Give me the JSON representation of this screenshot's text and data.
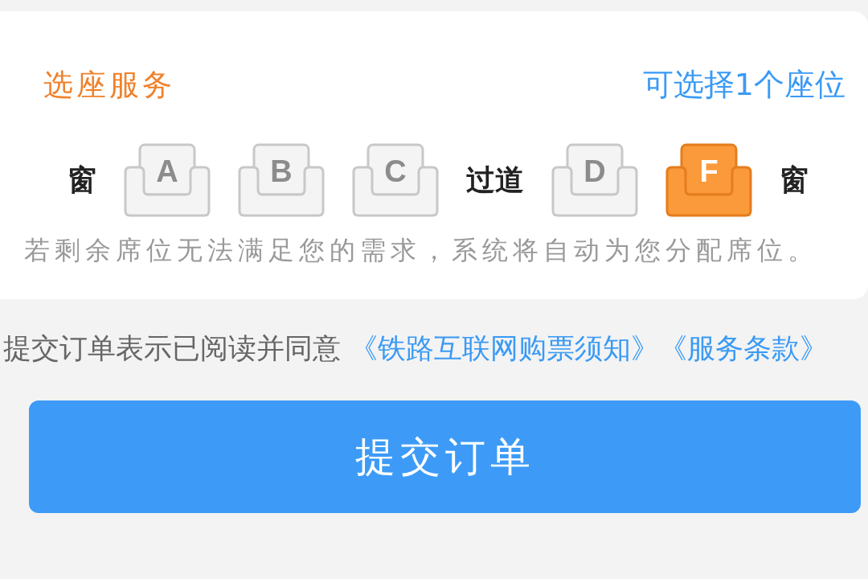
{
  "seat_card": {
    "title": "选座服务",
    "hint": "可选择1个座位",
    "row": [
      {
        "kind": "label",
        "text": "窗"
      },
      {
        "kind": "seat",
        "text": "A",
        "selected": false
      },
      {
        "kind": "seat",
        "text": "B",
        "selected": false
      },
      {
        "kind": "seat",
        "text": "C",
        "selected": false
      },
      {
        "kind": "label",
        "text": "过道"
      },
      {
        "kind": "seat",
        "text": "D",
        "selected": false
      },
      {
        "kind": "seat",
        "text": "F",
        "selected": true
      },
      {
        "kind": "label",
        "text": "窗"
      }
    ],
    "note": "若剩余席位无法满足您的需求，系统将自动为您分配席位。"
  },
  "agreement": {
    "text": "提交订单表示已阅读并同意",
    "links": [
      "《铁路互联网购票须知》",
      "《服务条款》"
    ]
  },
  "submit_button": "提交订单"
}
